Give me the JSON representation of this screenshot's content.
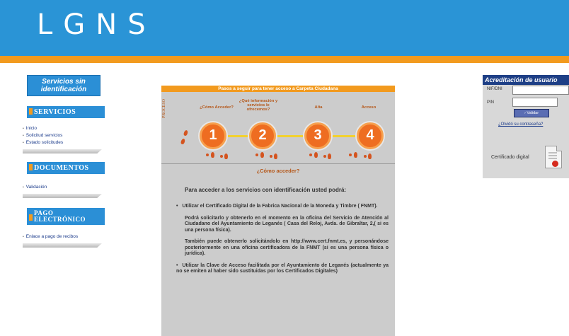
{
  "header": {
    "logo": "LGNS"
  },
  "sidebar": {
    "title": "Servicios sin identificación",
    "servicios": {
      "header": "SERVICIOS",
      "links": [
        "Inicio",
        "Solicitud servicios",
        "Estado solicitudes"
      ]
    },
    "documentos": {
      "header": "DOCUMENTOS",
      "links": [
        "Validación"
      ]
    },
    "pago": {
      "header_line1": "PAGO",
      "header_line2": "ELECTRÓNICO",
      "links": [
        "Enlace a pago de recibos"
      ]
    }
  },
  "main": {
    "title": "Pasos a seguir para tener acceso a Carpeta Ciudadana",
    "side_label": "PROCESO",
    "step_labels": [
      "¿Cómo Acceder?",
      "¿Qué información y servicios le ofrecemos?",
      "Alta",
      "Acceso"
    ],
    "steps": [
      "1",
      "2",
      "3",
      "4"
    ],
    "section_title": "¿Cómo acceder?",
    "intro": "Para acceder a los servicios con identificación usted podrá:",
    "bullet1": "Utilizar el Certificado Digital de la Fabrica Nacional de la Moneda y Timbre ( FNMT).",
    "para1": "Podrá solicitarlo y obtenerlo en el momento en la oficina del Servicio de Atención al Ciudadano del Ayuntamiento de Leganés ( Casa del Reloj, Avda. de Gibraltar, 2,( si es una persona física).",
    "para2": "También puede obtenerlo solicitándolo en http://www.cert.fnmt.es, y personándose posteriormente en una oficina certificadora de la FNMT (si es una persona física o jurídica).",
    "bullet2": "Utilizar la Clave de Acceso facilitada por el Ayuntamiento de Leganés (actualmente ya no se emiten al haber sido sustituidas por los Certificados Digitales)"
  },
  "acreditacion": {
    "title": "Acreditación de usuario",
    "nif_label": "NIF/DNI",
    "pin_label": "PIN",
    "button": "› Validar",
    "forgot": "¿Olvidó su contraseña?",
    "cert_label": "Certificado digital"
  },
  "colors": {
    "header_blue": "#2a94d6",
    "accent_orange": "#f29a1e",
    "step_orange": "#ee6d21",
    "acred_navy": "#1e3f86"
  }
}
